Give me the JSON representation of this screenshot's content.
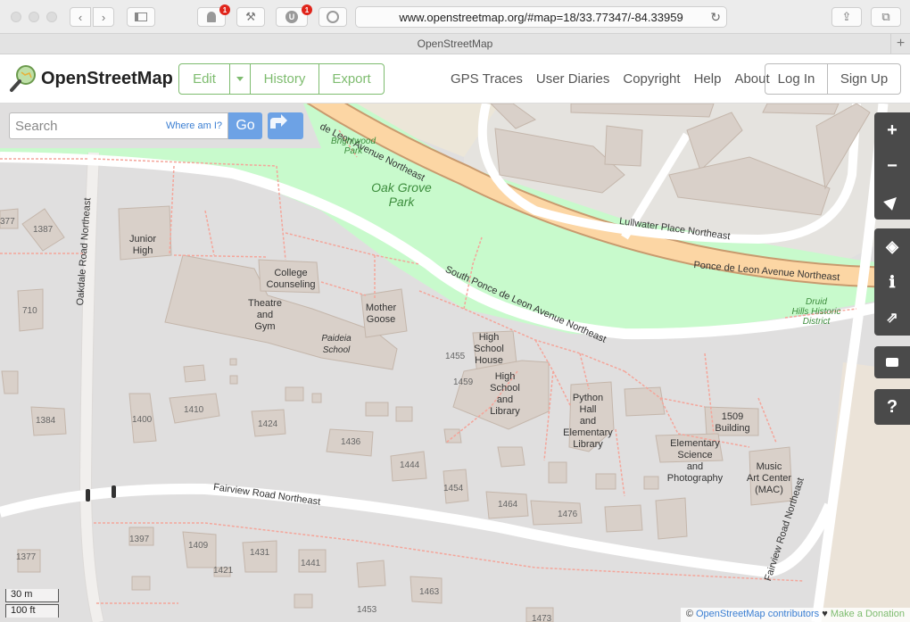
{
  "browser": {
    "url": "www.openstreetmap.org/#map=18/33.77347/-84.33959",
    "tab_title": "OpenStreetMap",
    "badge_1": "1",
    "badge_2": "1",
    "ext_u": "U"
  },
  "header": {
    "logo_text": "OpenStreetMap",
    "edit": "Edit",
    "history": "History",
    "export": "Export",
    "nav": [
      "GPS Traces",
      "User Diaries",
      "Copyright",
      "Help",
      "About"
    ],
    "login": "Log In",
    "signup": "Sign Up"
  },
  "search": {
    "placeholder": "Search",
    "where_am_i": "Where am I?",
    "go": "Go"
  },
  "controls": {
    "zoom_in": "+",
    "zoom_out": "−",
    "help": "?"
  },
  "scale": {
    "metric": "30 m",
    "imperial": "100 ft"
  },
  "attribution": {
    "prefix": "© ",
    "contributors": "OpenStreetMap contributors",
    "heart": " ♥ ",
    "donate": "Make a Donation"
  },
  "map_labels": {
    "streets": {
      "ponce_top": "de Leon Avenue Northeast",
      "ponce_right": "Ponce de Leon Avenue Northeast",
      "south_ponce": "South Ponce de Leon Avenue Northeast",
      "lullwater": "Lullwater Place Northeast",
      "oakdale": "Oakdale Road Northeast",
      "fairview": "Fairview Road Northeast",
      "fairview_right": "Fairview Road Northeast"
    },
    "parks": {
      "oak_grove_1": "Oak Grove",
      "oak_grove_2": "Park",
      "brightwood_1": "Brightwood",
      "brightwood_2": "Park",
      "druid_1": "Druid",
      "druid_2": "Hills Historic",
      "druid_3": "District"
    },
    "buildings": {
      "junior_1": "Junior",
      "junior_2": "High",
      "college_1": "College",
      "college_2": "Counseling",
      "theatre_1": "Theatre",
      "theatre_2": "and",
      "theatre_3": "Gym",
      "paideia_1": "Paideia",
      "paideia_2": "School",
      "mother_1": "Mother",
      "mother_2": "Goose",
      "hsh_1": "High",
      "hsh_2": "School",
      "hsh_3": "House",
      "hsl_1": "High",
      "hsl_2": "School",
      "hsl_3": "and",
      "hsl_4": "Library",
      "python_1": "Python",
      "python_2": "Hall",
      "python_3": "and",
      "python_4": "Elementary",
      "python_5": "Library",
      "b1509_1": "1509",
      "b1509_2": "Building",
      "elem_1": "Elementary",
      "elem_2": "Science",
      "elem_3": "and",
      "elem_4": "Photography",
      "music_1": "Music",
      "music_2": "Art Center",
      "music_3": "(MAC)"
    },
    "numbers": [
      "377",
      "1387",
      "710",
      "1384",
      "1400",
      "1410",
      "1424",
      "1436",
      "1444",
      "1454",
      "1464",
      "1476",
      "1455",
      "1459",
      "1397",
      "1409",
      "1431",
      "1441",
      "1421",
      "1377",
      "1463",
      "1453",
      "1473"
    ]
  }
}
